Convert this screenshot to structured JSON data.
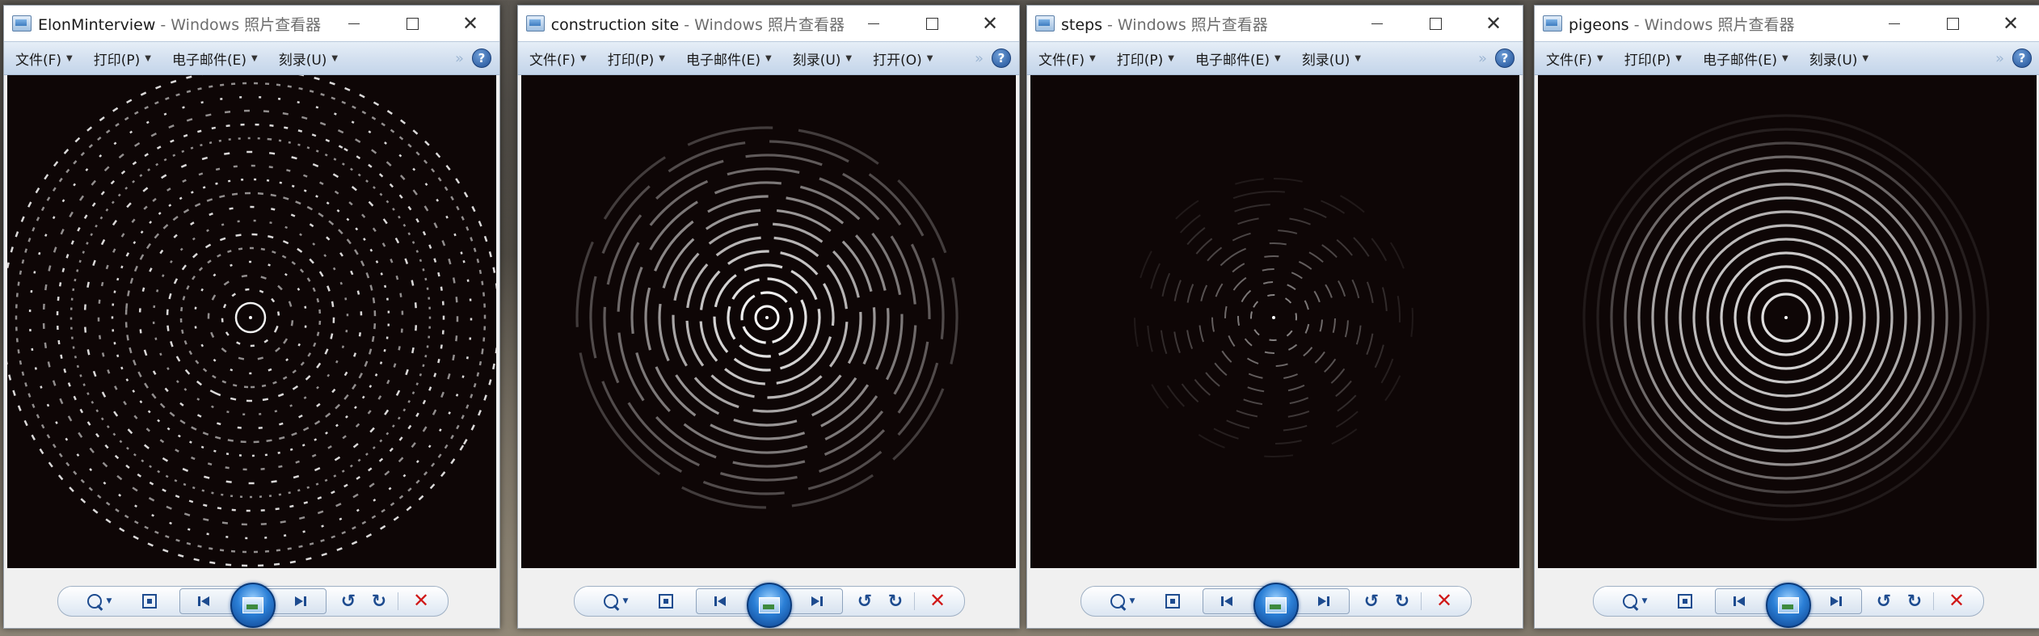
{
  "windows": [
    {
      "title": "ElonMinterview",
      "title_suffix": " - Windows 照片查看器",
      "menus": [
        "文件(F)",
        "打印(P)",
        "电子邮件(E)",
        "刻录(U)"
      ],
      "pattern": "scattered"
    },
    {
      "title": "construction site",
      "title_suffix": " - Windows 照片查看器",
      "menus": [
        "文件(F)",
        "打印(P)",
        "电子邮件(E)",
        "刻录(U)",
        "打开(O)"
      ],
      "pattern": "split"
    },
    {
      "title": "steps",
      "title_suffix": " - Windows 照片查看器",
      "menus": [
        "文件(F)",
        "打印(P)",
        "电子邮件(E)",
        "刻录(U)"
      ],
      "pattern": "faint"
    },
    {
      "title": "pigeons",
      "title_suffix": " - Windows 照片查看器",
      "menus": [
        "文件(F)",
        "打印(P)",
        "电子邮件(E)",
        "刻录(U)"
      ],
      "pattern": "rings"
    }
  ],
  "icons": {
    "app": "photo-viewer-icon",
    "minimize": "minimize-icon",
    "maximize": "maximize-icon",
    "close": "close-icon",
    "help": "help-icon",
    "zoom": "zoom-icon",
    "fit": "actual-size-icon",
    "previous": "previous-icon",
    "slideshow": "slideshow-icon",
    "next": "next-icon",
    "rotate_left": "rotate-left-icon",
    "rotate_right": "rotate-right-icon",
    "delete": "delete-icon"
  },
  "glyphs": {
    "close": "✕",
    "help": "?",
    "more": "»",
    "caret": "▼",
    "rotate_left": "↺",
    "rotate_right": "↻",
    "delete": "✕"
  },
  "colors": {
    "viewer_background": "#0e0606",
    "menubar": "#d2dfef",
    "accent": "#1d4b8f",
    "delete": "#d01818"
  }
}
